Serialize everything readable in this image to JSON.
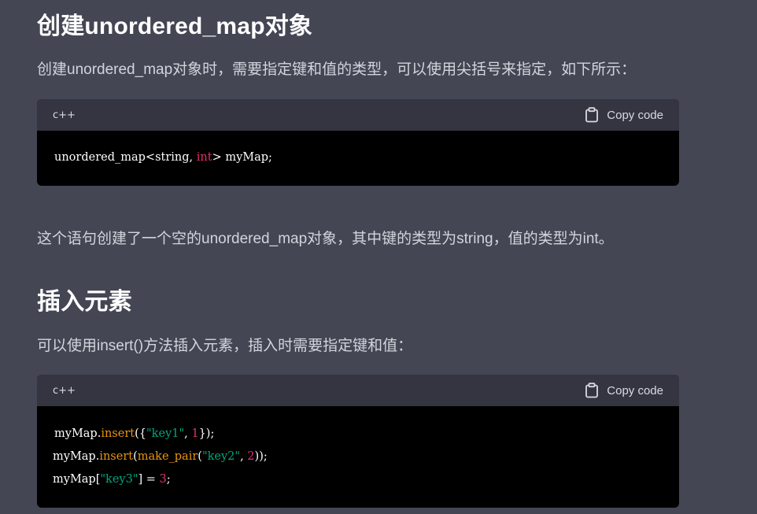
{
  "section1": {
    "heading": "创建unordered_map对象",
    "intro": "创建unordered_map对象时，需要指定键和值的类型，可以使用尖括号来指定，如下所示：",
    "code": {
      "lang": "c++",
      "copy_label": "Copy code",
      "line1": {
        "a": "unordered_map<string, ",
        "kw": "int",
        "b": "> myMap;"
      }
    },
    "after": "这个语句创建了一个空的unordered_map对象，其中键的类型为string，值的类型为int。"
  },
  "section2": {
    "heading": "插入元素",
    "intro": "可以使用insert()方法插入元素，插入时需要指定键和值：",
    "code": {
      "lang": "c++",
      "copy_label": "Copy code",
      "line1": {
        "a": "myMap.",
        "fn": "insert",
        "b": "({",
        "str": "\"key1\"",
        "c": ", ",
        "num": "1",
        "d": "});"
      },
      "line2": {
        "a": "myMap.",
        "fn": "insert",
        "b": "(",
        "fn2": "make_pair",
        "c": "(",
        "str": "\"key2\"",
        "d": ", ",
        "num": "2",
        "e": "));"
      },
      "line3": {
        "a": "myMap[",
        "str": "\"key3\"",
        "b": "] = ",
        "num": "3",
        "c": ";"
      }
    }
  },
  "colors": {
    "page_bg": "#444654",
    "code_header_bg": "#343541",
    "code_bg": "#000000",
    "keyword": "#e22d6a",
    "function": "#e9950c",
    "string": "#00a67d",
    "number": "#df3079"
  },
  "icons": {
    "copy": "clipboard-icon"
  }
}
